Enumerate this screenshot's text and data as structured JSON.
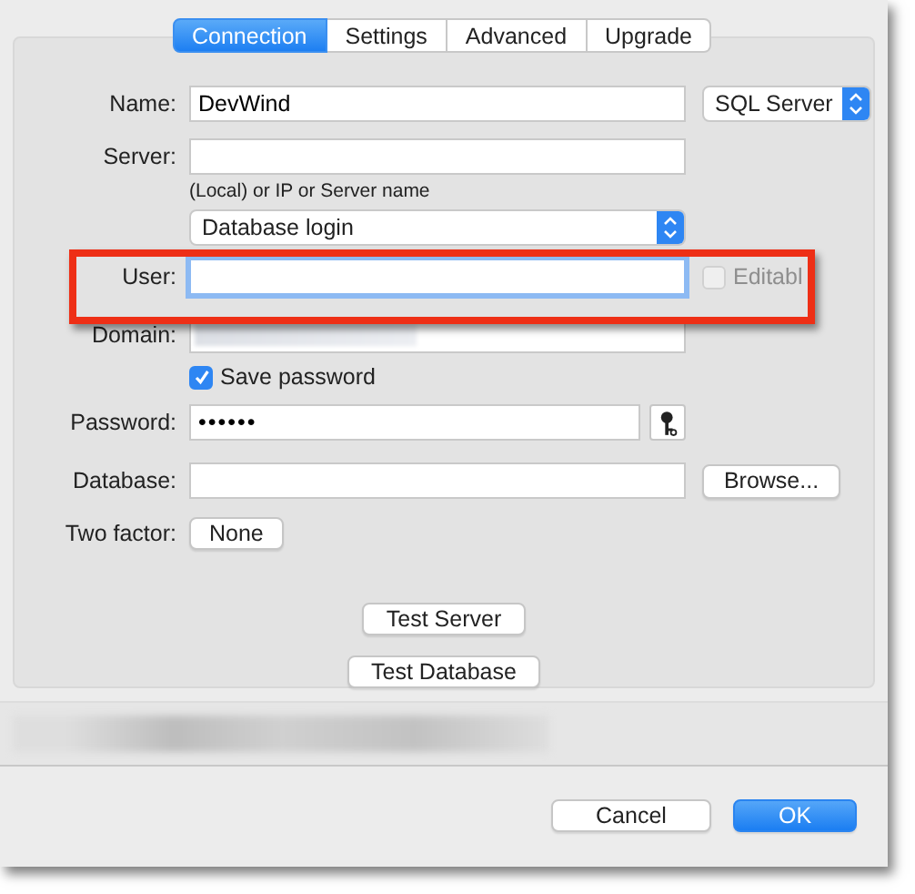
{
  "tabs": [
    {
      "label": "Connection",
      "selected": true
    },
    {
      "label": "Settings",
      "selected": false
    },
    {
      "label": "Advanced",
      "selected": false
    },
    {
      "label": "Upgrade",
      "selected": false
    }
  ],
  "name": {
    "label": "Name:",
    "value": "DevWind"
  },
  "driver_select": {
    "value": "SQL Server"
  },
  "server": {
    "label": "Server:",
    "hint": "(Local) or IP or Server name"
  },
  "auth_select": {
    "value": "Database login"
  },
  "user": {
    "label": "User:",
    "focused": true,
    "editable": {
      "label": "Editabl",
      "checked": false,
      "disabled": true
    }
  },
  "domain": {
    "label": "Domain:"
  },
  "save_password": {
    "label": "Save password",
    "checked": true
  },
  "password": {
    "label": "Password:",
    "value": "••••••"
  },
  "database": {
    "label": "Database:",
    "browse": "Browse..."
  },
  "two_factor": {
    "label": "Two factor:",
    "button": "None"
  },
  "test_buttons": [
    "Test Server",
    "Test Database"
  ],
  "footer_buttons": [
    {
      "label": "Cancel",
      "default": false
    },
    {
      "label": "OK",
      "default": true
    }
  ]
}
